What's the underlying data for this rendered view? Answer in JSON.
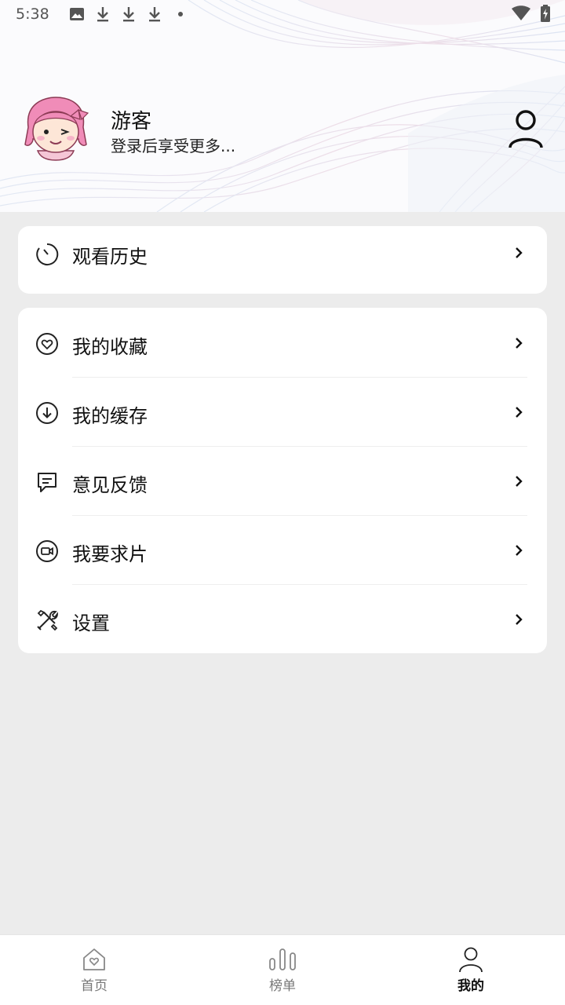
{
  "status_bar": {
    "time": "5:38",
    "left_icons": [
      "image-icon",
      "download-icon",
      "download-icon",
      "download-icon",
      "dot-icon"
    ],
    "right_icons": [
      "wifi-icon",
      "battery-charging-icon"
    ]
  },
  "profile": {
    "name": "游客",
    "subtitle": "登录后享受更多...",
    "avatar_icon": "girl-avatar-icon",
    "login_icon": "user-icon"
  },
  "menu": {
    "history": {
      "label": "观看历史",
      "icon": "clock-icon"
    },
    "items": [
      {
        "label": "我的收藏",
        "icon": "heart-circle-icon"
      },
      {
        "label": "我的缓存",
        "icon": "download-circle-icon"
      },
      {
        "label": "意见反馈",
        "icon": "message-icon"
      },
      {
        "label": "我要求片",
        "icon": "video-circle-icon"
      },
      {
        "label": "设置",
        "icon": "tools-icon"
      }
    ]
  },
  "bottom_nav": {
    "items": [
      {
        "label": "首页",
        "icon": "home-heart-icon",
        "active": false
      },
      {
        "label": "榜单",
        "icon": "bar-chart-icon",
        "active": false
      },
      {
        "label": "我的",
        "icon": "user-icon",
        "active": true
      }
    ]
  },
  "colors": {
    "background": "#ececec",
    "card": "#ffffff",
    "text": "#111111",
    "nav_inactive": "#777777",
    "avatar_pink": "#f08cb8"
  }
}
